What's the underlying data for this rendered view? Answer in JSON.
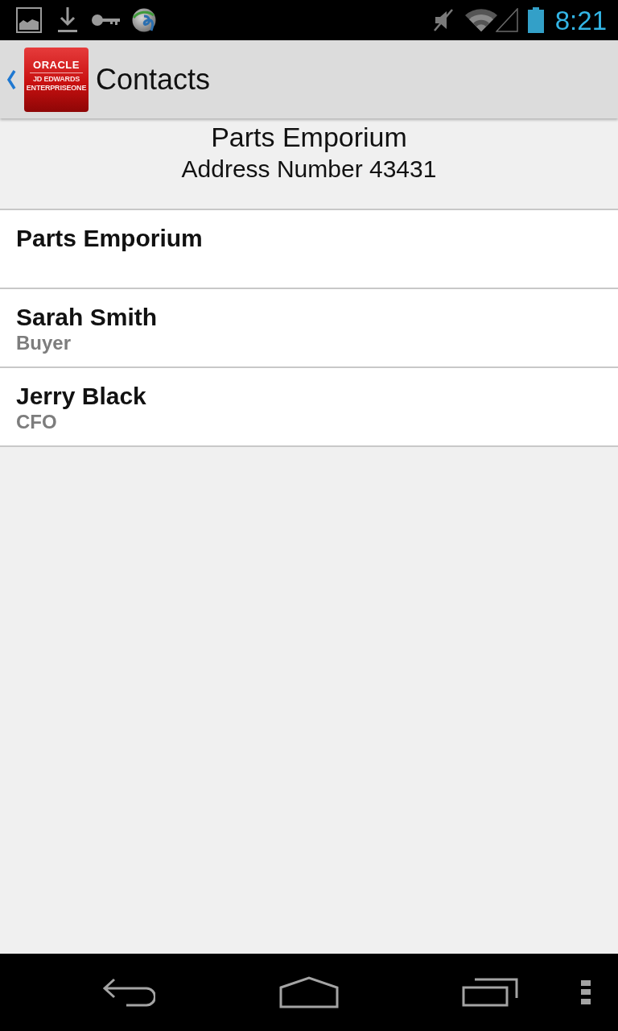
{
  "status_bar": {
    "time": "8:21"
  },
  "action_bar": {
    "title": "Contacts",
    "logo_lines": [
      "ORACLE",
      "JD EDWARDS",
      "ENTERPRISEONE"
    ]
  },
  "header": {
    "title": "Parts Emporium",
    "subtitle": "Address Number 43431"
  },
  "contacts": [
    {
      "name": "Parts Emporium"
    },
    {
      "name": "Sarah Smith",
      "role": "Buyer"
    },
    {
      "name": "Jerry Black",
      "role": "CFO"
    }
  ]
}
